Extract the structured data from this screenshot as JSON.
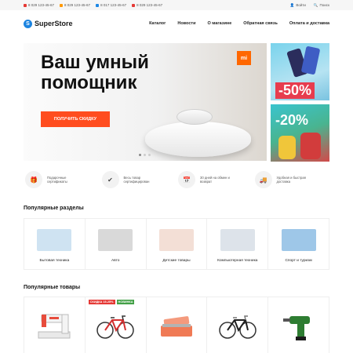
{
  "topbar": {
    "phones": [
      {
        "number": "8 029 123-45-67",
        "color": "#e53935"
      },
      {
        "number": "8 029 123-45-67",
        "color": "#ff9800"
      },
      {
        "number": "8 017 123-45-67",
        "color": "#1e88e5"
      },
      {
        "number": "8 029 123-45-67",
        "color": "#e53935"
      }
    ],
    "login_label": "Войти",
    "search_label": "Поиск"
  },
  "header": {
    "logo_mark": "S",
    "logo_text": "SuperStore",
    "nav": [
      "Каталог",
      "Новости",
      "О магазине",
      "Обратная связь",
      "Оплата и доставка"
    ]
  },
  "hero": {
    "title_line1": "Ваш умный",
    "title_line2": "помощник",
    "button_label": "ПОЛУЧИТЬ СКИДКУ",
    "brand_badge": "mi",
    "slides": 3,
    "active_slide": 0
  },
  "promos": [
    {
      "text": "-50%"
    },
    {
      "text": "-20%"
    }
  ],
  "features": [
    {
      "icon": "gift-icon",
      "glyph": "🎁",
      "text": "Подарочные сертификаты"
    },
    {
      "icon": "shield-check-icon",
      "glyph": "✔",
      "text": "Весь товар сертифицирован"
    },
    {
      "icon": "calendar-icon",
      "glyph": "📅",
      "text": "30 дней на обмен и возврат"
    },
    {
      "icon": "truck-icon",
      "glyph": "🚚",
      "text": "Удобная и быстрая доставка"
    }
  ],
  "sections": {
    "categories_title": "Популярные разделы",
    "products_title": "Популярные товары"
  },
  "categories": [
    {
      "label": "Бытовая техника",
      "icon": "appliances-image",
      "color": "#cfe3f2"
    },
    {
      "label": "Авто",
      "icon": "car-image",
      "color": "#d9d9d9"
    },
    {
      "label": "Детские товары",
      "icon": "baby-image",
      "color": "#f3dfd6"
    },
    {
      "label": "Компьютерная техника",
      "icon": "computer-image",
      "color": "#dde3ea"
    },
    {
      "label": "Спорт и туризм",
      "icon": "bikes-image",
      "color": "#9ec7e8"
    }
  ],
  "products": [
    {
      "icon": "sewing-machine-image",
      "badges": []
    },
    {
      "icon": "bicycle-image",
      "badges": [
        {
          "text": "СКИДКА 15-25%",
          "color": "#e53935"
        },
        {
          "text": "НОВИНКА",
          "color": "#43a047"
        }
      ]
    },
    {
      "icon": "toolbox-image",
      "badges": []
    },
    {
      "icon": "bicycle-image",
      "badges": []
    },
    {
      "icon": "drill-image",
      "badges": []
    }
  ]
}
